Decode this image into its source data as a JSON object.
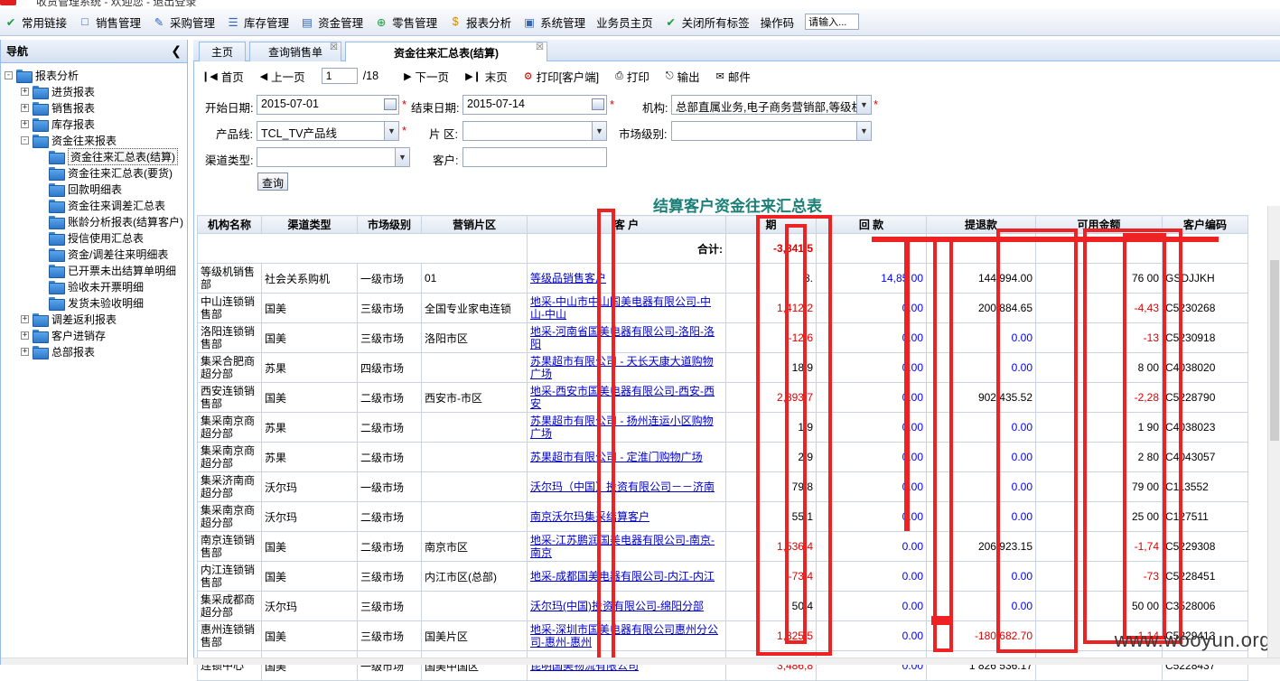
{
  "topbar": {
    "text": "收货管理系统 - 欢迎您 - 退出登录"
  },
  "toolbar": {
    "items": [
      {
        "label": "常用链接",
        "icon": "check-icon"
      },
      {
        "label": "销售管理",
        "icon": "document-icon"
      },
      {
        "label": "采购管理",
        "icon": "pencil-doc-icon"
      },
      {
        "label": "库存管理",
        "icon": "list-doc-icon"
      },
      {
        "label": "资金管理",
        "icon": "ledger-icon"
      },
      {
        "label": "零售管理",
        "icon": "plus-circle-icon"
      },
      {
        "label": "报表分析",
        "icon": "dollar-doc-icon"
      },
      {
        "label": "系统管理",
        "icon": "monitor-icon"
      },
      {
        "label": "业务员主页",
        "icon": ""
      },
      {
        "label": "关闭所有标签",
        "icon": "check-icon"
      },
      {
        "label": "操作码",
        "icon": ""
      }
    ],
    "opcode_placeholder": "请输入..."
  },
  "nav": {
    "title": "导航",
    "tree": [
      {
        "label": "报表分析",
        "level": 0,
        "expander": "−"
      },
      {
        "label": "进货报表",
        "level": 1,
        "expander": "+"
      },
      {
        "label": "销售报表",
        "level": 1,
        "expander": "+"
      },
      {
        "label": "库存报表",
        "level": 1,
        "expander": "+"
      },
      {
        "label": "资金往来报表",
        "level": 1,
        "expander": "−"
      },
      {
        "label": "资金往来汇总表(结算)",
        "level": 2,
        "expander": "",
        "selected": true
      },
      {
        "label": "资金往来汇总表(要货)",
        "level": 2,
        "expander": ""
      },
      {
        "label": "回款明细表",
        "level": 2,
        "expander": ""
      },
      {
        "label": "资金往来调差汇总表",
        "level": 2,
        "expander": ""
      },
      {
        "label": "账龄分析报表(结算客户)",
        "level": 2,
        "expander": ""
      },
      {
        "label": "授信使用汇总表",
        "level": 2,
        "expander": ""
      },
      {
        "label": "资金/调差往来明细表",
        "level": 2,
        "expander": ""
      },
      {
        "label": "已开票未出结算单明细",
        "level": 2,
        "expander": ""
      },
      {
        "label": "验收未开票明细",
        "level": 2,
        "expander": ""
      },
      {
        "label": "发货未验收明细",
        "level": 2,
        "expander": ""
      },
      {
        "label": "调差返利报表",
        "level": 1,
        "expander": "+"
      },
      {
        "label": "客户进销存",
        "level": 1,
        "expander": "+"
      },
      {
        "label": "总部报表",
        "level": 1,
        "expander": "+"
      }
    ]
  },
  "tabs": [
    {
      "label": "主页",
      "closable": false
    },
    {
      "label": "查询销售单",
      "closable": true
    },
    {
      "label": "资金往来汇总表(结算)",
      "closable": true,
      "active": true
    }
  ],
  "pager": {
    "first": "首页",
    "prev": "上一页",
    "page": "1",
    "total": "/18",
    "next": "下一页",
    "last": "末页",
    "print_client": "打印[客户端]",
    "print": "打印",
    "export": "输出",
    "mail": "邮件"
  },
  "filters": {
    "start_label": "开始日期:",
    "start_value": "2015-07-01",
    "end_label": "结束日期:",
    "end_value": "2015-07-14",
    "org_label": "机构:",
    "org_value": "总部直属业务,电子商务营销部,等级机",
    "product_label": "产品线:",
    "product_value": "TCL_TV产品线",
    "area_label": "片 区:",
    "area_value": "",
    "market_label": "市场级别:",
    "market_value": "",
    "channel_label": "渠道类型:",
    "channel_value": "",
    "customer_label": "客户:",
    "customer_value": "",
    "query_button": "查询"
  },
  "report": {
    "title": "结算客户资金往来汇总表",
    "headers": [
      "机构名称",
      "渠道类型",
      "市场级别",
      "营销片区",
      "客 户",
      "期",
      "回 款",
      "提退款",
      "可用金额",
      "客户编码"
    ],
    "total_label": "合计:",
    "total_values": [
      "-3,841,5",
      "",
      "",
      ""
    ],
    "rows": [
      {
        "org": "等级机销售部",
        "channel": "社会关系购机",
        "market": "一级市场",
        "area": "01",
        "customer": "等级品销售客户",
        "period": "8.",
        "received": "14,85 00",
        "refund": "144 994.00",
        "avail": "76 00",
        "code": "GSDJJKH",
        "p_neg": false,
        "a_neg": false
      },
      {
        "org": "中山连锁销售部",
        "channel": "国美",
        "market": "三级市场",
        "area": "全国专业家电连锁",
        "customer": "地采-中山市中山国美电器有限公司-中山-中山",
        "period": "1,412,2",
        "received": "0.00",
        "refund": "200 884.65",
        "avail": "-4,43",
        "code": "C5230268",
        "p_neg": true,
        "a_neg": true
      },
      {
        "org": "洛阳连锁销售部",
        "channel": "国美",
        "market": "三级市场",
        "area": "洛阳市区",
        "customer": "地采-河南省国美电器有限公司-洛阳-洛阳",
        "period": "-12,6",
        "received": "0.00",
        "refund": "0.00",
        "avail": "-13",
        "code": "C5230918",
        "p_neg": true,
        "a_neg": true
      },
      {
        "org": "集采合肥商超分部",
        "channel": "苏果",
        "market": "四级市场",
        "area": "",
        "customer": "苏果超市有限公司 - 天长天康大道购物广场",
        "period": "18,9",
        "received": "0.00",
        "refund": "0.00",
        "avail": "8 00",
        "code": "C4038020",
        "p_neg": false,
        "a_neg": false
      },
      {
        "org": "西安连锁销售部",
        "channel": "国美",
        "market": "二级市场",
        "area": "西安市-市区",
        "customer": "地采-西安市国美电器有限公司-西安-西安",
        "period": "2,393,7",
        "received": "0.00",
        "refund": "902 435.52",
        "avail": "-2,28",
        "code": "C5228790",
        "p_neg": true,
        "a_neg": true
      },
      {
        "org": "集采南京商超分部",
        "channel": "苏果",
        "market": "二级市场",
        "area": "",
        "customer": "苏果超市有限公司 - 扬州连运小区购物广场",
        "period": "1,9",
        "received": "0.00",
        "refund": "0.00",
        "avail": "1 90",
        "code": "C4038023",
        "p_neg": false,
        "a_neg": false
      },
      {
        "org": "集采南京商超分部",
        "channel": "苏果",
        "market": "二级市场",
        "area": "",
        "customer": "苏果超市有限公司 - 定淮门购物广场",
        "period": "2,9",
        "received": "0.00",
        "refund": "0.00",
        "avail": "2 80",
        "code": "C4043057",
        "p_neg": false,
        "a_neg": false
      },
      {
        "org": "集采济南商超分部",
        "channel": "沃尔玛",
        "market": "一级市场",
        "area": "",
        "customer": "沃尔玛（中国）投资有限公司－－济南",
        "period": "79,8",
        "received": "0.00",
        "refund": "0.00",
        "avail": "79 00",
        "code": "C113552",
        "p_neg": false,
        "a_neg": false
      },
      {
        "org": "集采南京商超分部",
        "channel": "沃尔玛",
        "market": "二级市场",
        "area": "",
        "customer": "南京沃尔玛集采结算客户",
        "period": "55,1",
        "received": "0.00",
        "refund": "0.00",
        "avail": "25 00",
        "code": "C127511",
        "p_neg": false,
        "a_neg": false
      },
      {
        "org": "南京连锁销售部",
        "channel": "国美",
        "market": "二级市场",
        "area": "南京市区",
        "customer": "地采-江苏鹏润国美电器有限公司-南京-南京",
        "period": "1,536,4",
        "received": "0.00",
        "refund": "206 923.15",
        "avail": "-1,74",
        "code": "C5229308",
        "p_neg": true,
        "a_neg": true
      },
      {
        "org": "内江连锁销售部",
        "channel": "国美",
        "market": "三级市场",
        "area": "内江市区(总部)",
        "customer": "地采-成都国美电器有限公司-内江-内江",
        "period": "-73,4",
        "received": "0.00",
        "refund": "0.00",
        "avail": "-73",
        "code": "C5228451",
        "p_neg": true,
        "a_neg": true
      },
      {
        "org": "集采成都商超分部",
        "channel": "沃尔玛",
        "market": "三级市场",
        "area": "",
        "customer": "沃尔玛(中国)投资有限公司-绵阳分部",
        "period": "50,4",
        "received": "0.00",
        "refund": "0.00",
        "avail": "50 00",
        "code": "C3528006",
        "p_neg": false,
        "a_neg": false
      },
      {
        "org": "惠州连锁销售部",
        "channel": "国美",
        "market": "三级市场",
        "area": "国美片区",
        "customer": "地采-深圳市国美电器有限公司惠州分公司-惠州-惠州",
        "period": "1,325,5",
        "received": "0.00",
        "refund": "-180 682.70",
        "avail": "-1,14",
        "code": "C5229413",
        "p_neg": true,
        "a_neg": true
      },
      {
        "org": "连锁中心",
        "channel": "国美",
        "market": "一级市场",
        "area": "国美中国区",
        "customer": "昆明国美物流有限公司",
        "period": "3,486,8",
        "received": "0.00",
        "refund": "1 826 536.17",
        "avail": "",
        "code": "C5228437",
        "p_neg": true,
        "a_neg": false
      }
    ]
  },
  "colors": {
    "accent": "#1a7f77",
    "negative": "#e00000",
    "link": "#0000c8",
    "annotation": "#ee2222"
  },
  "watermark": "www.wooyun.org"
}
